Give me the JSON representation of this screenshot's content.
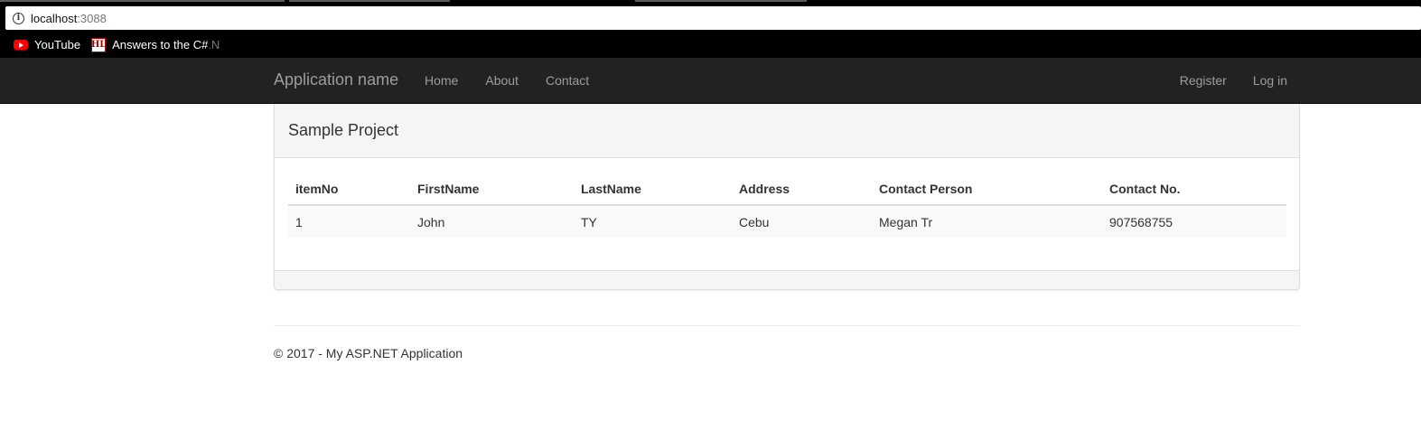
{
  "browser": {
    "url_host": "localhost",
    "url_port": ":3088",
    "bookmarks": [
      {
        "label": "YouTube",
        "icon": "youtube-icon"
      },
      {
        "label": "Answers to the C#",
        "faded": " .N",
        "icon": "hl-icon",
        "icon_text": "HL"
      }
    ]
  },
  "navbar": {
    "brand": "Application name",
    "links": [
      "Home",
      "About",
      "Contact"
    ],
    "right_links": [
      "Register",
      "Log in"
    ]
  },
  "panel": {
    "title": "Sample Project",
    "table": {
      "headers": [
        "itemNo",
        "FirstName",
        "LastName",
        "Address",
        "Contact Person",
        "Contact No."
      ],
      "rows": [
        [
          "1",
          "John",
          "TY",
          "Cebu",
          "Megan Tr",
          "907568755"
        ]
      ]
    }
  },
  "footer": {
    "copyright": "© 2017 - My ASP.NET Application"
  },
  "colors": {
    "navbar_bg": "#222222",
    "nav_text": "#9d9d9d",
    "panel_heading_bg": "#f5f5f5",
    "row_stripe": "#f9f9f9"
  }
}
